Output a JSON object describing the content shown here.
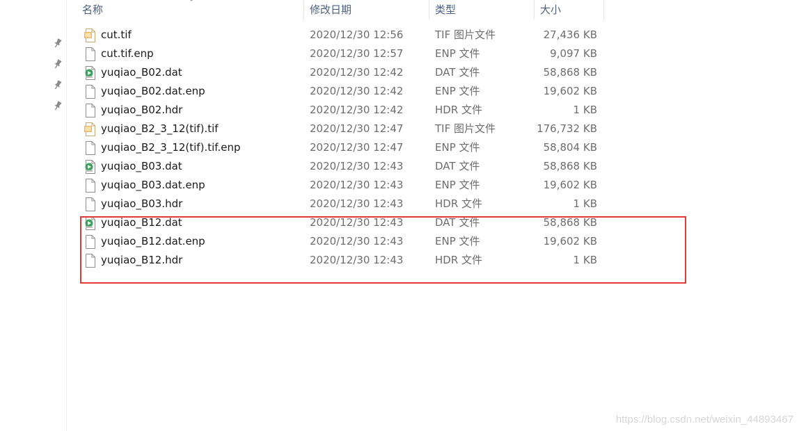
{
  "columns": {
    "name": "名称",
    "date": "修改日期",
    "type": "类型",
    "size": "大小"
  },
  "files": [
    {
      "name": "cut.tif",
      "date": "2020/12/30 12:56",
      "type": "TIF 图片文件",
      "size": "27,436 KB",
      "icon": "image-file-icon"
    },
    {
      "name": "cut.tif.enp",
      "date": "2020/12/30 12:57",
      "type": "ENP 文件",
      "size": "9,097 KB",
      "icon": "blank-file-icon"
    },
    {
      "name": "yuqiao_B02.dat",
      "date": "2020/12/30 12:42",
      "type": "DAT 文件",
      "size": "58,868 KB",
      "icon": "media-file-icon"
    },
    {
      "name": "yuqiao_B02.dat.enp",
      "date": "2020/12/30 12:42",
      "type": "ENP 文件",
      "size": "19,602 KB",
      "icon": "blank-file-icon"
    },
    {
      "name": "yuqiao_B02.hdr",
      "date": "2020/12/30 12:42",
      "type": "HDR 文件",
      "size": "1 KB",
      "icon": "blank-file-icon"
    },
    {
      "name": "yuqiao_B2_3_12(tif).tif",
      "date": "2020/12/30 12:47",
      "type": "TIF 图片文件",
      "size": "176,732 KB",
      "icon": "image-file-icon"
    },
    {
      "name": "yuqiao_B2_3_12(tif).tif.enp",
      "date": "2020/12/30 12:47",
      "type": "ENP 文件",
      "size": "58,804 KB",
      "icon": "blank-file-icon"
    },
    {
      "name": "yuqiao_B03.dat",
      "date": "2020/12/30 12:43",
      "type": "DAT 文件",
      "size": "58,868 KB",
      "icon": "media-file-icon"
    },
    {
      "name": "yuqiao_B03.dat.enp",
      "date": "2020/12/30 12:43",
      "type": "ENP 文件",
      "size": "19,602 KB",
      "icon": "blank-file-icon"
    },
    {
      "name": "yuqiao_B03.hdr",
      "date": "2020/12/30 12:43",
      "type": "HDR 文件",
      "size": "1 KB",
      "icon": "blank-file-icon"
    },
    {
      "name": "yuqiao_B12.dat",
      "date": "2020/12/30 12:43",
      "type": "DAT 文件",
      "size": "58,868 KB",
      "icon": "media-file-icon"
    },
    {
      "name": "yuqiao_B12.dat.enp",
      "date": "2020/12/30 12:43",
      "type": "ENP 文件",
      "size": "19,602 KB",
      "icon": "blank-file-icon"
    },
    {
      "name": "yuqiao_B12.hdr",
      "date": "2020/12/30 12:43",
      "type": "HDR 文件",
      "size": "1 KB",
      "icon": "blank-file-icon"
    }
  ],
  "watermark": "https://blog.csdn.net/weixin_44893467",
  "colors": {
    "highlight": "#e53935",
    "header_text": "#4d6082",
    "secondary_text": "#6d6d6d"
  },
  "icons": {
    "pin": "pin-icon",
    "sort": "sort-caret-icon"
  }
}
